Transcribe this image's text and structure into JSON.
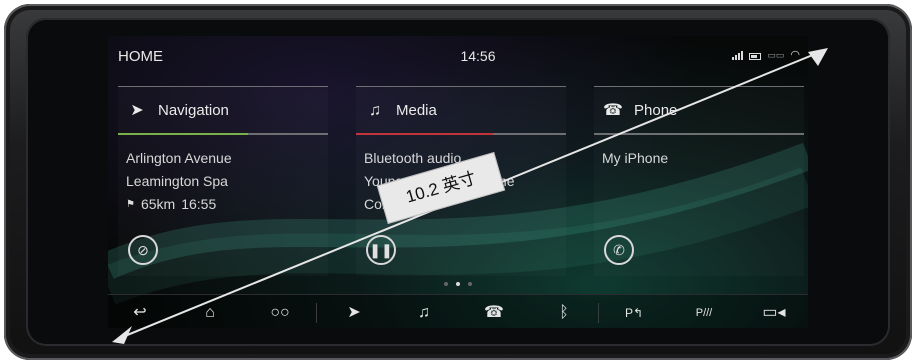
{
  "status": {
    "home": "HOME",
    "time": "14:56"
  },
  "navigation": {
    "title": "Navigation",
    "street": "Arlington Avenue",
    "city": "Leamington Spa",
    "distance": "65km",
    "eta": "16:55",
    "accent": "#7ab04a"
  },
  "media": {
    "title": "Media",
    "source": "Bluetooth audio",
    "track": "Young Before Your Time",
    "artist": "Corvidae",
    "accent": "#c0343a"
  },
  "phone": {
    "title": "Phone",
    "device": "My iPhone"
  },
  "annotation": {
    "label": "10.2 英寸"
  },
  "dock": {
    "icons": [
      "back-icon",
      "home-icon",
      "connected-icon",
      "navigation-icon",
      "media-icon",
      "phone-icon",
      "bluetooth-icon",
      "park-assist-icon",
      "parking-sensor-icon",
      "camera-icon"
    ]
  }
}
